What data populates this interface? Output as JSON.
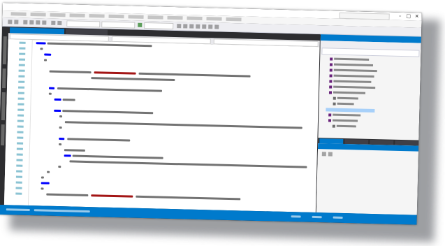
{
  "window": {
    "title": "",
    "title_bar_color": "#ffffff",
    "controls": [
      "minimize-icon",
      "maximize-icon",
      "close-icon"
    ],
    "control_glyphs": [
      "–",
      "□",
      "✕"
    ]
  },
  "menubar": {
    "color": "#f6f6f6"
  },
  "toolbar": {
    "color": "#eeeef2"
  },
  "editor": {
    "active_tab_color": "#007acc",
    "background": "#ffffff",
    "keyword_color": "#0000ff",
    "string_color": "#a31515",
    "line_number_color": "#2b91af"
  },
  "solution_explorer": {
    "header_color": "#007acc",
    "background": "#f5f5f5"
  },
  "statusbar": {
    "color": "#007acc"
  },
  "chrome_color": "#2d2d30"
}
